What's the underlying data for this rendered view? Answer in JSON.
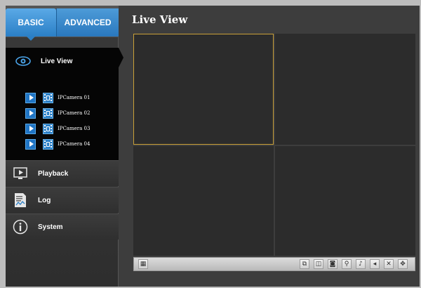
{
  "tabs": {
    "basic": "BASIC",
    "advanced": "ADVANCED"
  },
  "sidebar": {
    "live_view": {
      "label": "Live View",
      "icon": "eye-icon",
      "cameras": [
        "IPCamera 01",
        "IPCamera 02",
        "IPCamera 03",
        "IPCamera 04"
      ]
    },
    "items": [
      {
        "label": "Playback",
        "icon": "playback-icon"
      },
      {
        "label": "Log",
        "icon": "log-icon"
      },
      {
        "label": "System",
        "icon": "info-icon"
      }
    ]
  },
  "header": {
    "title": "Live View"
  },
  "toolbar": {
    "left_button": "layout-icon",
    "right_buttons": [
      "snapshot-icon",
      "record-icon",
      "camera-icon",
      "zoom-icon",
      "mic-icon",
      "volume-icon",
      "close-all-icon",
      "ptz-icon"
    ]
  },
  "colors": {
    "accent": "#2b7fc6",
    "selected_pane_border": "#c9a038"
  }
}
